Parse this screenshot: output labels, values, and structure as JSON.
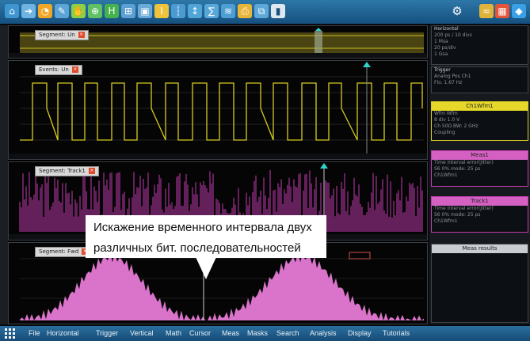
{
  "toolbar": {
    "icons": [
      "home-icon",
      "arrow-icon",
      "clock-icon",
      "edit-icon",
      "hand-icon",
      "zoom-icon",
      "histogram-icon",
      "zoom-window-icon",
      "mask-icon",
      "trigger-marker-icon",
      "cursor-icon",
      "measure-icon",
      "math-icon",
      "chart-icon",
      "print-icon",
      "dot-icon"
    ],
    "right_icons": [
      "gear-icon",
      "signal-icon",
      "waveform-icon",
      "diamond-icon"
    ]
  },
  "diagrams": {
    "d1": {
      "tab": "Segment: Un"
    },
    "d2": {
      "tab": "Events: Un"
    },
    "d3": {
      "tab": "Segment: Track1"
    },
    "d4": {
      "tab": "Segment: Fwd"
    }
  },
  "right_panel": {
    "horizontal": {
      "title": "Horizontal",
      "lines": [
        "200 ps / 10 divs",
        "1 Msa",
        "20 ps/div",
        "1 Gsa"
      ]
    },
    "trigger": {
      "title": "Trigger",
      "lines": [
        "Analog  Pos  Ch1",
        "Flo.  1.67 Hz"
      ]
    },
    "ch1": {
      "title": "Ch1Wfm1",
      "lines": [
        "Wfm Wfm",
        "8 div      1.0 V",
        "Ch 50Ω   BW: 2 GHz",
        "Coupling"
      ]
    },
    "meas1": {
      "title": "Meas1",
      "lines": [
        "Time interval error(Jitter)",
        "S6 0%   mode: 25 ps",
        "Ch1Wfm1"
      ]
    },
    "track1": {
      "title": "Track1",
      "lines": [
        "Time interval error(Jitter)",
        "S6 0%   mode: 25 ps",
        "Ch1Wfm1"
      ]
    },
    "meas_results": {
      "title": "Meas results"
    }
  },
  "menu": {
    "items": [
      "File",
      "Horizontal",
      "Trigger",
      "Vertical",
      "Math",
      "Cursor",
      "Meas",
      "Masks",
      "Search",
      "Analysis",
      "Display",
      "Tutorials"
    ]
  },
  "callout": {
    "line1": "Искажение временного интервала двух",
    "line2": "различных бит. последовательностей"
  },
  "colors": {
    "waveform_yellow": "#d8cc22",
    "waveform_magenta": "#c23cb0",
    "histogram_pink": "#e67ad6",
    "toolbar_blue": "#2d77a8",
    "marker_cyan": "#2fd3c9"
  }
}
